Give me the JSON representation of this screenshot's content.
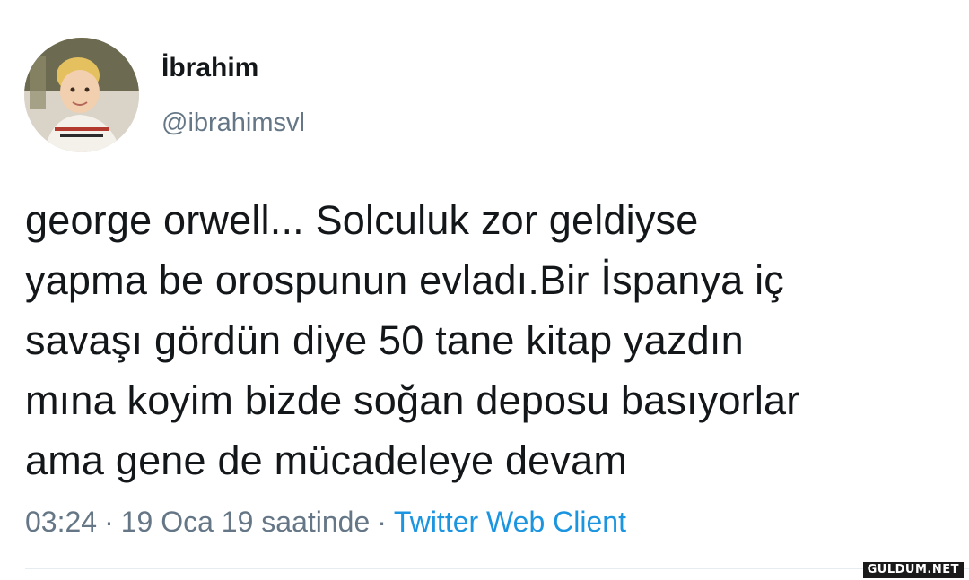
{
  "user": {
    "display_name": "İbrahim",
    "handle": "@ibrahimsvl"
  },
  "tweet": {
    "lines": [
      "george orwell... Solculuk zor geldiyse",
      "yapma be orospunun evladı.Bir İspanya iç",
      "savaşı gördün diye 50 tane kitap yazdın",
      "mına koyim bizde soğan deposu basıyorlar",
      "ama gene de mücadeleye devam"
    ]
  },
  "meta": {
    "time": "03:24",
    "date": "19 Oca 19 saatinde",
    "separator": "·",
    "client": "Twitter Web Client"
  },
  "watermark": "GULDUM.NET",
  "colors": {
    "text": "#14171a",
    "secondary": "#657786",
    "link": "#1b95e0",
    "divider": "#e6ecf0"
  }
}
